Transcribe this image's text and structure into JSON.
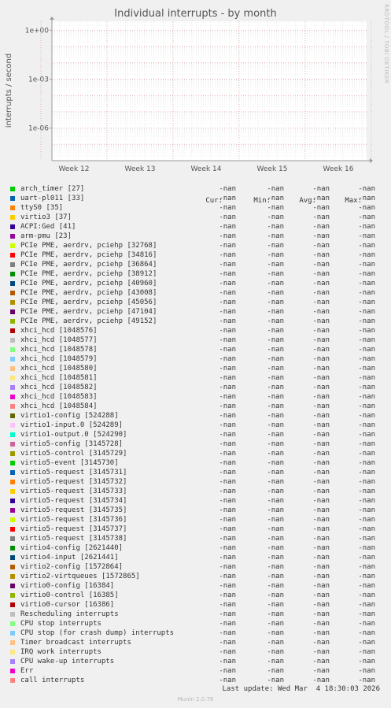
{
  "chart_data": {
    "type": "line",
    "title": "Individual interrupts - by month",
    "ylabel": "interrupts / second",
    "yscale": "log",
    "y_ticks": [
      "1e+00",
      "1e-03",
      "1e-06"
    ],
    "x_ticks": [
      "Week 12",
      "Week 13",
      "Week 14",
      "Week 15",
      "Week 16"
    ],
    "grid": true,
    "legend_columns": [
      "Cur:",
      "Min:",
      "Avg:",
      "Max:"
    ],
    "series": [
      {
        "name": "arch_timer [27]",
        "color": "#00cc00",
        "cur": "-nan",
        "min": "-nan",
        "avg": "-nan",
        "max": "-nan"
      },
      {
        "name": "uart-pl011 [33]",
        "color": "#0066b3",
        "cur": "-nan",
        "min": "-nan",
        "avg": "-nan",
        "max": "-nan"
      },
      {
        "name": "ttyS0 [35]",
        "color": "#ff8000",
        "cur": "-nan",
        "min": "-nan",
        "avg": "-nan",
        "max": "-nan"
      },
      {
        "name": "virtio3 [37]",
        "color": "#ffcc00",
        "cur": "-nan",
        "min": "-nan",
        "avg": "-nan",
        "max": "-nan"
      },
      {
        "name": "ACPI:Ged [41]",
        "color": "#330099",
        "cur": "-nan",
        "min": "-nan",
        "avg": "-nan",
        "max": "-nan"
      },
      {
        "name": "arm-pmu [23]",
        "color": "#990099",
        "cur": "-nan",
        "min": "-nan",
        "avg": "-nan",
        "max": "-nan"
      },
      {
        "name": "PCIe PME, aerdrv, pciehp [32768]",
        "color": "#ccff00",
        "cur": "-nan",
        "min": "-nan",
        "avg": "-nan",
        "max": "-nan"
      },
      {
        "name": "PCIe PME, aerdrv, pciehp [34816]",
        "color": "#ff0000",
        "cur": "-nan",
        "min": "-nan",
        "avg": "-nan",
        "max": "-nan"
      },
      {
        "name": "PCIe PME, aerdrv, pciehp [36864]",
        "color": "#808080",
        "cur": "-nan",
        "min": "-nan",
        "avg": "-nan",
        "max": "-nan"
      },
      {
        "name": "PCIe PME, aerdrv, pciehp [38912]",
        "color": "#008f00",
        "cur": "-nan",
        "min": "-nan",
        "avg": "-nan",
        "max": "-nan"
      },
      {
        "name": "PCIe PME, aerdrv, pciehp [40960]",
        "color": "#00487d",
        "cur": "-nan",
        "min": "-nan",
        "avg": "-nan",
        "max": "-nan"
      },
      {
        "name": "PCIe PME, aerdrv, pciehp [43008]",
        "color": "#b35a00",
        "cur": "-nan",
        "min": "-nan",
        "avg": "-nan",
        "max": "-nan"
      },
      {
        "name": "PCIe PME, aerdrv, pciehp [45056]",
        "color": "#b38f00",
        "cur": "-nan",
        "min": "-nan",
        "avg": "-nan",
        "max": "-nan"
      },
      {
        "name": "PCIe PME, aerdrv, pciehp [47104]",
        "color": "#6b006b",
        "cur": "-nan",
        "min": "-nan",
        "avg": "-nan",
        "max": "-nan"
      },
      {
        "name": "PCIe PME, aerdrv, pciehp [49152]",
        "color": "#8fb300",
        "cur": "-nan",
        "min": "-nan",
        "avg": "-nan",
        "max": "-nan"
      },
      {
        "name": "xhci_hcd [1048576]",
        "color": "#b30000",
        "cur": "-nan",
        "min": "-nan",
        "avg": "-nan",
        "max": "-nan"
      },
      {
        "name": "xhci_hcd [1048577]",
        "color": "#bebebe",
        "cur": "-nan",
        "min": "-nan",
        "avg": "-nan",
        "max": "-nan"
      },
      {
        "name": "xhci_hcd [1048578]",
        "color": "#80ff80",
        "cur": "-nan",
        "min": "-nan",
        "avg": "-nan",
        "max": "-nan"
      },
      {
        "name": "xhci_hcd [1048579]",
        "color": "#80c9ff",
        "cur": "-nan",
        "min": "-nan",
        "avg": "-nan",
        "max": "-nan"
      },
      {
        "name": "xhci_hcd [1048580]",
        "color": "#ffc080",
        "cur": "-nan",
        "min": "-nan",
        "avg": "-nan",
        "max": "-nan"
      },
      {
        "name": "xhci_hcd [1048581]",
        "color": "#ffe680",
        "cur": "-nan",
        "min": "-nan",
        "avg": "-nan",
        "max": "-nan"
      },
      {
        "name": "xhci_hcd [1048582]",
        "color": "#aa80ff",
        "cur": "-nan",
        "min": "-nan",
        "avg": "-nan",
        "max": "-nan"
      },
      {
        "name": "xhci_hcd [1048583]",
        "color": "#ee00cc",
        "cur": "-nan",
        "min": "-nan",
        "avg": "-nan",
        "max": "-nan"
      },
      {
        "name": "xhci_hcd [1048584]",
        "color": "#ff8080",
        "cur": "-nan",
        "min": "-nan",
        "avg": "-nan",
        "max": "-nan"
      },
      {
        "name": "virtio1-config [524288]",
        "color": "#666600",
        "cur": "-nan",
        "min": "-nan",
        "avg": "-nan",
        "max": "-nan"
      },
      {
        "name": "virtio1-input.0 [524289]",
        "color": "#ffbfff",
        "cur": "-nan",
        "min": "-nan",
        "avg": "-nan",
        "max": "-nan"
      },
      {
        "name": "virtio1-output.0 [524290]",
        "color": "#00ffcc",
        "cur": "-nan",
        "min": "-nan",
        "avg": "-nan",
        "max": "-nan"
      },
      {
        "name": "virtio5-config [3145728]",
        "color": "#cc6699",
        "cur": "-nan",
        "min": "-nan",
        "avg": "-nan",
        "max": "-nan"
      },
      {
        "name": "virtio5-control [3145729]",
        "color": "#999900",
        "cur": "-nan",
        "min": "-nan",
        "avg": "-nan",
        "max": "-nan"
      },
      {
        "name": "virtio5-event [3145730]",
        "color": "#00cc00",
        "cur": "-nan",
        "min": "-nan",
        "avg": "-nan",
        "max": "-nan"
      },
      {
        "name": "virtio5-request [3145731]",
        "color": "#0066b3",
        "cur": "-nan",
        "min": "-nan",
        "avg": "-nan",
        "max": "-nan"
      },
      {
        "name": "virtio5-request [3145732]",
        "color": "#ff8000",
        "cur": "-nan",
        "min": "-nan",
        "avg": "-nan",
        "max": "-nan"
      },
      {
        "name": "virtio5-request [3145733]",
        "color": "#ffcc00",
        "cur": "-nan",
        "min": "-nan",
        "avg": "-nan",
        "max": "-nan"
      },
      {
        "name": "virtio5-request [3145734]",
        "color": "#330099",
        "cur": "-nan",
        "min": "-nan",
        "avg": "-nan",
        "max": "-nan"
      },
      {
        "name": "virtio5-request [3145735]",
        "color": "#990099",
        "cur": "-nan",
        "min": "-nan",
        "avg": "-nan",
        "max": "-nan"
      },
      {
        "name": "virtio5-request [3145736]",
        "color": "#ccff00",
        "cur": "-nan",
        "min": "-nan",
        "avg": "-nan",
        "max": "-nan"
      },
      {
        "name": "virtio5-request [3145737]",
        "color": "#ff0000",
        "cur": "-nan",
        "min": "-nan",
        "avg": "-nan",
        "max": "-nan"
      },
      {
        "name": "virtio5-request [3145738]",
        "color": "#808080",
        "cur": "-nan",
        "min": "-nan",
        "avg": "-nan",
        "max": "-nan"
      },
      {
        "name": "virtio4-config [2621440]",
        "color": "#008f00",
        "cur": "-nan",
        "min": "-nan",
        "avg": "-nan",
        "max": "-nan"
      },
      {
        "name": "virtio4-input [2621441]",
        "color": "#00487d",
        "cur": "-nan",
        "min": "-nan",
        "avg": "-nan",
        "max": "-nan"
      },
      {
        "name": "virtio2-config [1572864]",
        "color": "#b35a00",
        "cur": "-nan",
        "min": "-nan",
        "avg": "-nan",
        "max": "-nan"
      },
      {
        "name": "virtio2-virtqueues [1572865]",
        "color": "#b38f00",
        "cur": "-nan",
        "min": "-nan",
        "avg": "-nan",
        "max": "-nan"
      },
      {
        "name": "virtio0-config [16384]",
        "color": "#6b006b",
        "cur": "-nan",
        "min": "-nan",
        "avg": "-nan",
        "max": "-nan"
      },
      {
        "name": "virtio0-control [16385]",
        "color": "#8fb300",
        "cur": "-nan",
        "min": "-nan",
        "avg": "-nan",
        "max": "-nan"
      },
      {
        "name": "virtio0-cursor [16386]",
        "color": "#b30000",
        "cur": "-nan",
        "min": "-nan",
        "avg": "-nan",
        "max": "-nan"
      },
      {
        "name": "Rescheduling interrupts",
        "color": "#bebebe",
        "cur": "-nan",
        "min": "-nan",
        "avg": "-nan",
        "max": "-nan"
      },
      {
        "name": "CPU stop interrupts",
        "color": "#80ff80",
        "cur": "-nan",
        "min": "-nan",
        "avg": "-nan",
        "max": "-nan"
      },
      {
        "name": "CPU stop (for crash dump) interrupts",
        "color": "#80c9ff",
        "cur": "-nan",
        "min": "-nan",
        "avg": "-nan",
        "max": "-nan"
      },
      {
        "name": "Timer broadcast interrupts",
        "color": "#ffc080",
        "cur": "-nan",
        "min": "-nan",
        "avg": "-nan",
        "max": "-nan"
      },
      {
        "name": "IRQ work interrupts",
        "color": "#ffe680",
        "cur": "-nan",
        "min": "-nan",
        "avg": "-nan",
        "max": "-nan"
      },
      {
        "name": "CPU wake-up interrupts",
        "color": "#aa80ff",
        "cur": "-nan",
        "min": "-nan",
        "avg": "-nan",
        "max": "-nan"
      },
      {
        "name": "Err",
        "color": "#ee00cc",
        "cur": "-nan",
        "min": "-nan",
        "avg": "-nan",
        "max": "-nan"
      },
      {
        "name": "call interrupts",
        "color": "#ff8080",
        "cur": "-nan",
        "min": "-nan",
        "avg": "-nan",
        "max": "-nan"
      }
    ]
  },
  "watermark": "RRDTOOL / TOBI OETIKER",
  "last_update": "Last update: Wed Mar  4 18:30:03 2026",
  "version": "Munin 2.0.76"
}
